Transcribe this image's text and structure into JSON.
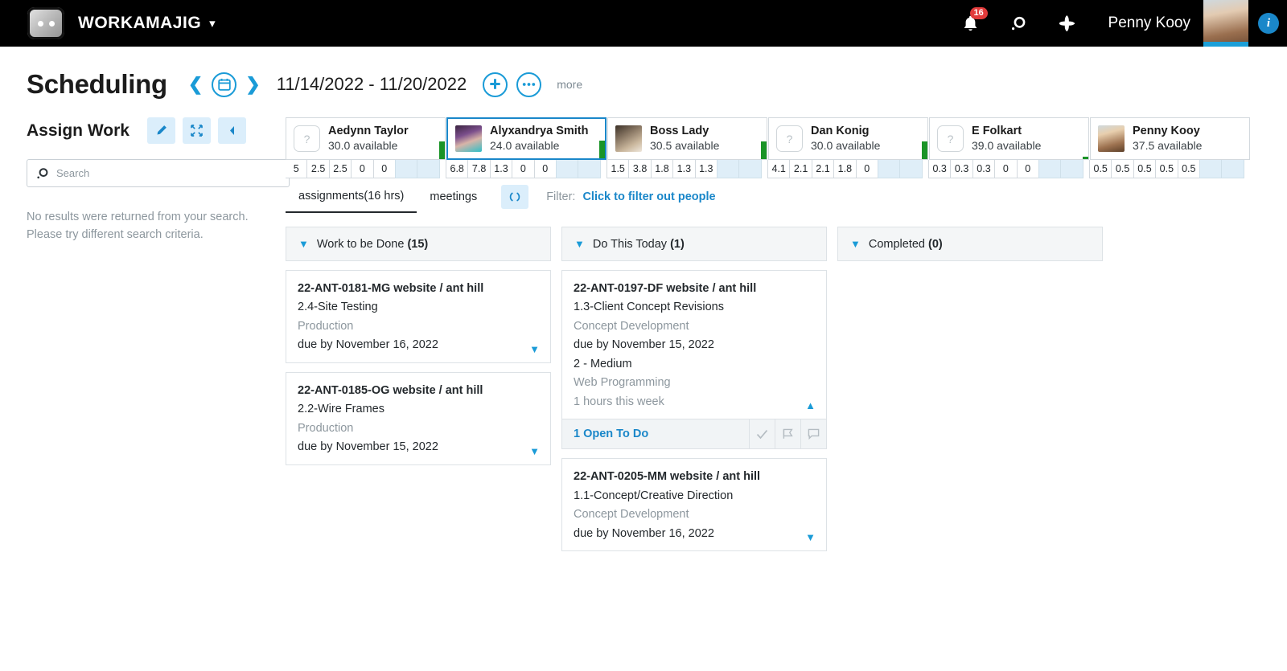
{
  "topnav": {
    "brand": "WORKAMAJIG",
    "brand_caret": "chevron-down",
    "notifications_count": "16",
    "user_name": "Penny Kooy",
    "info_label": "i"
  },
  "page_head": {
    "title": "Scheduling",
    "date_range": "11/14/2022 - 11/20/2022",
    "more_label": "more"
  },
  "left_panel": {
    "title": "Assign Work",
    "buttons": [
      {
        "name": "edit-button",
        "icon": "pencil-icon"
      },
      {
        "name": "collapse-button",
        "icon": "compress-icon"
      },
      {
        "name": "hide-panel-button",
        "icon": "chevron-left-icon"
      }
    ],
    "search_placeholder": "Search",
    "search_value": "",
    "empty_message": "No results were returned from your search. Please try different search criteria."
  },
  "people": [
    {
      "name": "Aedynn Taylor",
      "available": "30.0 available",
      "avatar": "placeholder",
      "selected": false,
      "indicator": "full",
      "hours": [
        "5",
        "2.5",
        "2.5",
        "0",
        "0",
        "",
        ""
      ]
    },
    {
      "name": "Alyxandrya Smith",
      "available": "24.0 available",
      "avatar": "photo-1",
      "selected": true,
      "indicator": "full",
      "hours": [
        "6.8",
        "7.8",
        "1.3",
        "0",
        "0",
        "",
        ""
      ]
    },
    {
      "name": "Boss Lady",
      "available": "30.5 available",
      "avatar": "photo-2",
      "selected": false,
      "indicator": "full",
      "hours": [
        "1.5",
        "3.8",
        "1.8",
        "1.3",
        "1.3",
        "",
        ""
      ]
    },
    {
      "name": "Dan Konig",
      "available": "30.0 available",
      "avatar": "placeholder",
      "selected": false,
      "indicator": "full",
      "hours": [
        "4.1",
        "2.1",
        "2.1",
        "1.8",
        "0",
        "",
        ""
      ]
    },
    {
      "name": "E Folkart",
      "available": "39.0 available",
      "avatar": "placeholder",
      "selected": false,
      "indicator": "tiny",
      "hours": [
        "0.3",
        "0.3",
        "0.3",
        "0",
        "0",
        "",
        ""
      ]
    },
    {
      "name": "Penny Kooy",
      "available": "37.5 available",
      "avatar": "photo-3",
      "selected": false,
      "indicator": "none",
      "hours": [
        "0.5",
        "0.5",
        "0.5",
        "0.5",
        "0.5",
        "",
        ""
      ]
    }
  ],
  "tabs": {
    "assignments": "assignments(16 hrs)",
    "meetings": "meetings",
    "refresh_icon": "refresh-icon",
    "filter_label": "Filter:",
    "filter_link": "Click to filter out people"
  },
  "columns": [
    {
      "title": "Work to be Done",
      "count": "(15)",
      "cards": [
        {
          "code": "22-ANT-0181-MG website / ant hill",
          "task": "2.4-Site Testing",
          "dept": "Production",
          "due": "due by November 16, 2022",
          "caret": "down"
        },
        {
          "code": "22-ANT-0185-OG website / ant hill",
          "task": "2.2-Wire Frames",
          "dept": "Production",
          "due": "due by November 15, 2022",
          "caret": "down"
        }
      ]
    },
    {
      "title": "Do This Today",
      "count": "(1)",
      "cards": [
        {
          "code": "22-ANT-0197-DF website / ant hill",
          "task": "1.3-Client Concept Revisions",
          "dept": "Concept Development",
          "due": "due by November 15, 2022",
          "priority": "2 - Medium",
          "category": "Web Programming",
          "hours_week": "1 hours this week",
          "caret": "up",
          "footer": {
            "link": "1 Open To Do",
            "icons": [
              "check-icon",
              "flag-icon",
              "comment-icon"
            ]
          }
        },
        {
          "code": "22-ANT-0205-MM website / ant hill",
          "task": "1.1-Concept/Creative Direction",
          "dept": "Concept Development",
          "due": "due by November 16, 2022",
          "caret": "down"
        }
      ]
    },
    {
      "title": "Completed",
      "count": "(0)",
      "cards": []
    }
  ],
  "colors": {
    "accent": "#1a87c9",
    "accent_light": "#1a9bd7",
    "nav_bg": "#000000",
    "available_green": "#1a9427",
    "badge_red": "#e23b3b",
    "weekend_cell": "#dfeef8"
  }
}
